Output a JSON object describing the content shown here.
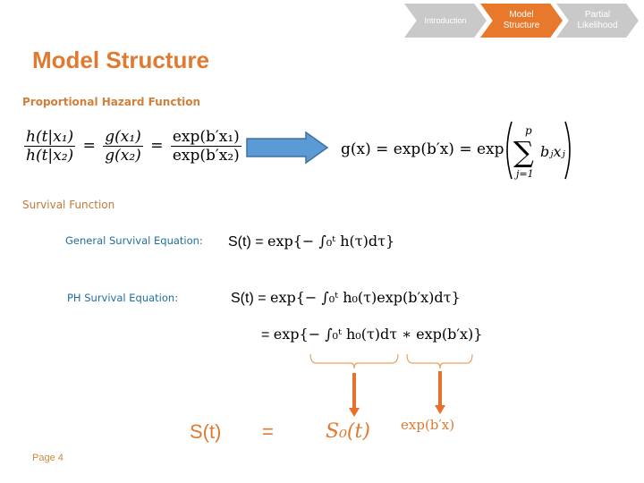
{
  "nav": {
    "steps": [
      {
        "label": "Introduction",
        "state": "inactive"
      },
      {
        "label": "Model Structure",
        "state": "active"
      },
      {
        "label": "Partial Likelihood",
        "state": "inactive"
      }
    ],
    "colors": {
      "active": "#e8782c",
      "inactive": "#c9c9c9"
    }
  },
  "page": {
    "title": "Model Structure",
    "footer": "Page 4"
  },
  "sections": {
    "proportional_hazard": {
      "heading": "Proportional Hazard Function",
      "ratio_equation": {
        "lhs_num": "h(t|x₁)",
        "lhs_den": "h(t|x₂)",
        "mid_num": "g(x₁)",
        "mid_den": "g(x₂)",
        "rhs_num": "exp(b′x₁)",
        "rhs_den": "exp(b′x₂)"
      },
      "arrow_icon": "right-arrow",
      "g_equation": {
        "lhs": "g(x) = exp(b′x) = exp",
        "sum_upper": "p",
        "sum_lower": "j=1",
        "sum_term": "bⱼxⱼ"
      }
    },
    "survival": {
      "heading": "Survival Function",
      "general_label": "General Survival Equation:",
      "general_equation": {
        "lhs": "S(t) = ",
        "rhs": "exp{− ∫₀ᵗ h(τ)dτ}"
      },
      "ph_label": "PH Survival Equation:",
      "ph_equation_line1": {
        "lhs": "S(t) = ",
        "rhs": "exp{− ∫₀ᵗ h₀(τ)exp(b′x)dτ}"
      },
      "ph_equation_line2": {
        "lhs": "= ",
        "rhs": "exp{− ∫₀ᵗ h₀(τ)dτ ∗ exp(b′x)}"
      },
      "result": {
        "lhs": "S(t)",
        "eq": "=",
        "base": "S₀(t)",
        "exponent": "exp(b′x)"
      }
    }
  }
}
